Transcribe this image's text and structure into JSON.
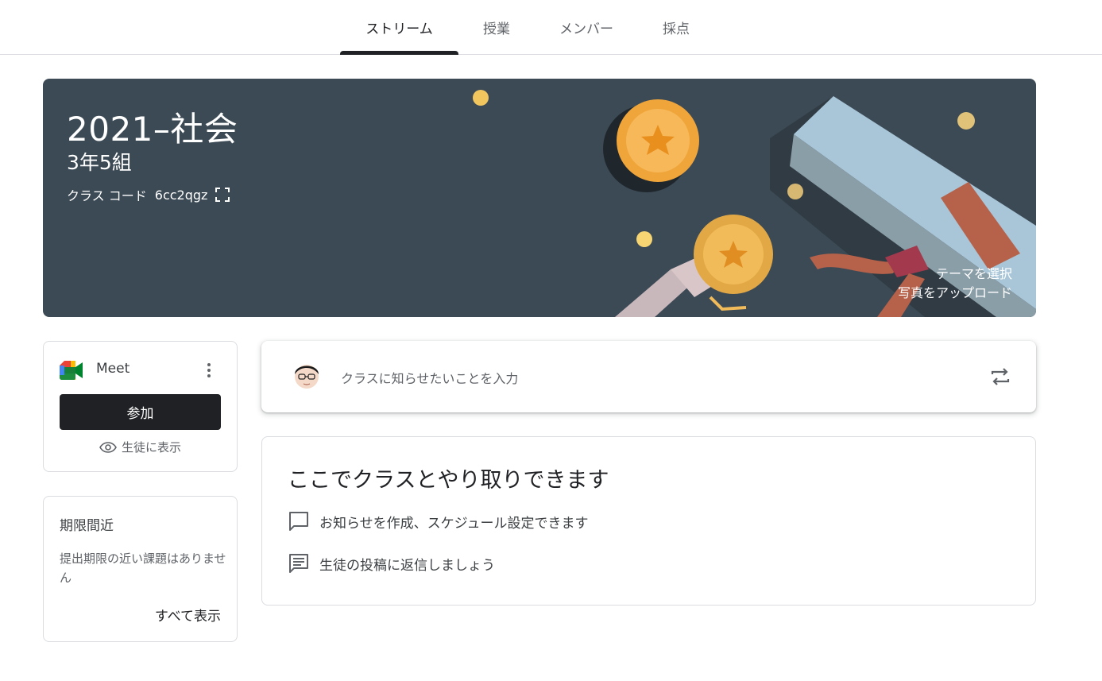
{
  "tabs": [
    {
      "label": "ストリーム",
      "active": true
    },
    {
      "label": "授業",
      "active": false
    },
    {
      "label": "メンバー",
      "active": false
    },
    {
      "label": "採点",
      "active": false
    }
  ],
  "banner": {
    "title": "2021–社会",
    "section": "3年5組",
    "class_code_label": "クラス コード",
    "class_code": "6cc2qgz",
    "select_theme": "テーマを選択",
    "upload_photo": "写真をアップロード",
    "background_color": "#3c4a55"
  },
  "meet": {
    "label": "Meet",
    "join_label": "参加",
    "visible_label": "生徒に表示"
  },
  "upcoming": {
    "title": "期限間近",
    "message": "提出期限の近い課題はありません",
    "view_all": "すべて表示"
  },
  "announce": {
    "placeholder": "クラスに知らせたいことを入力"
  },
  "info": {
    "title": "ここでクラスとやり取りできます",
    "items": [
      {
        "icon": "comment-icon",
        "text": "お知らせを作成、スケジュール設定できます"
      },
      {
        "icon": "chat-lines-icon",
        "text": "生徒の投稿に返信しましょう"
      }
    ]
  }
}
